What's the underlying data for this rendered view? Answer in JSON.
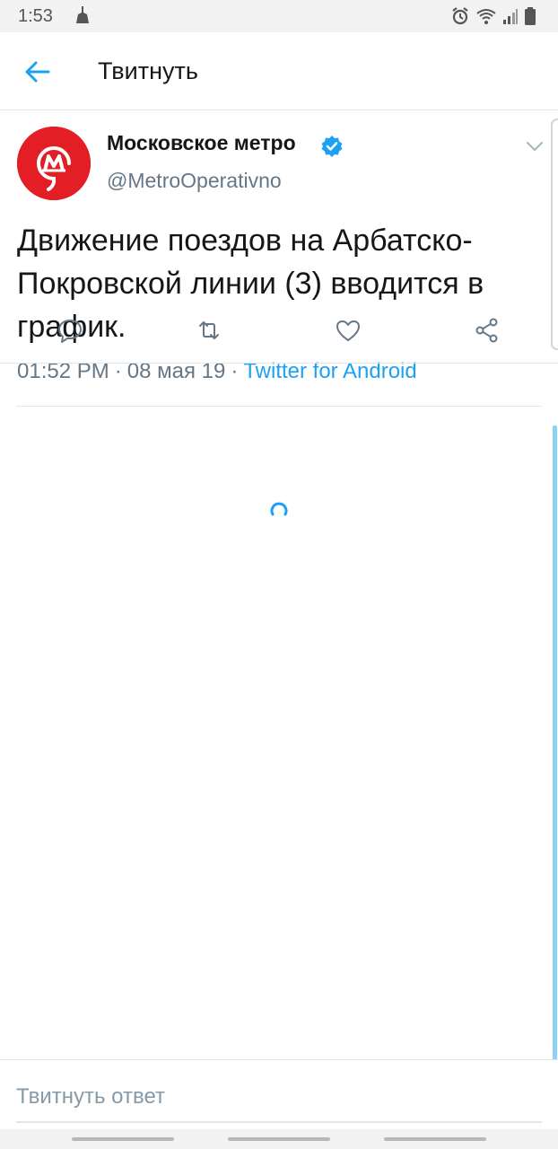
{
  "status_bar": {
    "time": "1:53",
    "left_icon": "cleaning-app-icon",
    "right_icons": [
      "alarm-icon",
      "wifi-icon",
      "signal-icon",
      "battery-icon"
    ]
  },
  "app_bar": {
    "back_icon": "arrow-left-icon",
    "title": "Твитнуть"
  },
  "tweet": {
    "author_name": "Московское метро",
    "verified_icon": "verified-badge-icon",
    "handle": "@MetroOperativno",
    "text": "Движение поездов на Арбатско-Покровской линии (3) вводится в график.",
    "time": "01:52 PM",
    "separator": "·",
    "date": "08 мая 19",
    "source": "Twitter for Android",
    "caret_icon": "chevron-down-icon"
  },
  "actions": [
    {
      "name": "reply",
      "icon": "reply-icon"
    },
    {
      "name": "retweet",
      "icon": "retweet-icon"
    },
    {
      "name": "like",
      "icon": "heart-icon"
    },
    {
      "name": "share",
      "icon": "share-icon"
    }
  ],
  "loading": {
    "icon": "loading-spinner-icon"
  },
  "reply_bar": {
    "placeholder": "Твитнуть ответ"
  },
  "colors": {
    "accent": "#1da1f2",
    "metro_red": "#e31e24",
    "secondary_text": "#657786",
    "divider": "#e1e8ed"
  }
}
